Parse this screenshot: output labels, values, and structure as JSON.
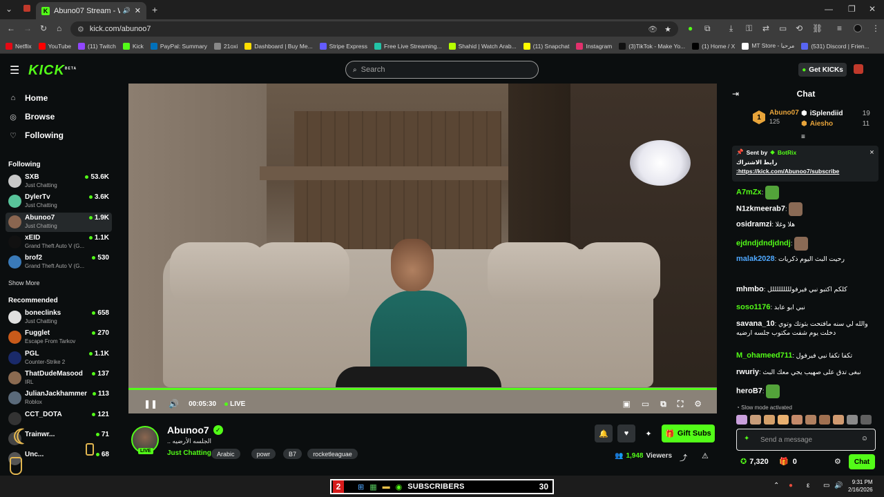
{
  "browser": {
    "tab_title": "Abuno07 Stream - Watch L",
    "url": "kick.com/abunoo7",
    "bookmarks": [
      {
        "label": "Netflix",
        "color": "#e50914"
      },
      {
        "label": "YouTube",
        "color": "#ff0000"
      },
      {
        "label": "(11) Twitch",
        "color": "#9146ff"
      },
      {
        "label": "Kick",
        "color": "#53fc18"
      },
      {
        "label": "PayPal: Summary",
        "color": "#0070ba"
      },
      {
        "label": "21oxi",
        "color": "#888888"
      },
      {
        "label": "Dashboard | Buy Me...",
        "color": "#ffdd00"
      },
      {
        "label": "Stripe Express",
        "color": "#635bff"
      },
      {
        "label": "Free Live Streaming...",
        "color": "#22c3a6"
      },
      {
        "label": "Shahid | Watch Arab...",
        "color": "#b5ff00"
      },
      {
        "label": "(11) Snapchat",
        "color": "#fffc00"
      },
      {
        "label": "Instagram",
        "color": "#e1306c"
      },
      {
        "label": "(3)TikTok - Make Yo...",
        "color": "#111111"
      },
      {
        "label": "(1) Home / X",
        "color": "#000000"
      },
      {
        "label": "MT Store - مرحبا",
        "color": "#ffffff"
      },
      {
        "label": "(531) Discord | Frien...",
        "color": "#5865f2"
      }
    ]
  },
  "header": {
    "logo": "KICK",
    "logo_sup": "BETA",
    "search_placeholder": "Search",
    "get_kicks": "Get KICKs"
  },
  "sidebar": {
    "nav": [
      {
        "label": "Home",
        "icon": "home-icon"
      },
      {
        "label": "Browse",
        "icon": "compass-icon"
      },
      {
        "label": "Following",
        "icon": "heart-icon"
      }
    ],
    "following_title": "Following",
    "following": [
      {
        "name": "SXB",
        "category": "Just Chatting",
        "viewers": "53.6K",
        "color": "#c8c8c8"
      },
      {
        "name": "DylerTv",
        "category": "Just Chatting",
        "viewers": "3.6K",
        "color": "#58c49a"
      },
      {
        "name": "Abunoo7",
        "category": "Just Chatting",
        "viewers": "1.9K",
        "color": "#8a6650"
      },
      {
        "name": "xEID",
        "category": "Grand Theft Auto V (G...",
        "viewers": "1.1K",
        "color": "#111111"
      },
      {
        "name": "brof2",
        "category": "Grand Theft Auto V (G...",
        "viewers": "530",
        "color": "#3a7ab8"
      }
    ],
    "show_more": "Show More",
    "recommended_title": "Recommended",
    "recommended": [
      {
        "name": "boneclinks",
        "category": "Just Chatting",
        "viewers": "658",
        "color": "#e0e0e0"
      },
      {
        "name": "Fugglet",
        "category": "Escape From Tarkov",
        "viewers": "270",
        "color": "#c85a1a"
      },
      {
        "name": "PGL",
        "category": "Counter-Strike 2",
        "viewers": "1.1K",
        "color": "#1a2a6a"
      },
      {
        "name": "ThatDudeMasood",
        "category": "IRL",
        "viewers": "137",
        "color": "#8a6a50"
      },
      {
        "name": "JulianJackhammer",
        "category": "Roblox",
        "viewers": "113",
        "color": "#5a6a7a"
      },
      {
        "name": "CCT_DOTA",
        "category": "",
        "viewers": "121",
        "color": "#333333"
      },
      {
        "name": "Trainwr...",
        "category": "",
        "viewers": "71",
        "color": "#444444"
      },
      {
        "name": "Unc...",
        "category": "",
        "viewers": "68",
        "color": "#555555"
      }
    ]
  },
  "player": {
    "time": "00:05:30",
    "live": "LIVE",
    "progress": 1.0
  },
  "stream": {
    "name": "Abunoo7",
    "title": "الجلسه الأرضيه ..",
    "live_badge": "LIVE",
    "category": "Just Chatting",
    "tags": [
      "Arabic",
      "powr",
      "B7",
      "rocketleaguae"
    ],
    "gift_subs": "Gift Subs",
    "viewers": "1,948",
    "viewers_label": "Viewers"
  },
  "chat": {
    "title": "Chat",
    "leaderboard": [
      {
        "rank": "1",
        "name": "Abuno07",
        "count": "125",
        "color": "#e8a43a"
      },
      {
        "name": "iSplendiid",
        "count": "19",
        "color": "#ffffff"
      },
      {
        "name": "Aiesho",
        "count": "11",
        "color": "#e8a43a"
      }
    ],
    "pinned": {
      "sent_by": "Sent by",
      "sender": "BotRix",
      "line1": "رابط الاشتراك",
      "line2": ":https://kick.com/Abunoo7/subscribe"
    },
    "messages": [
      {
        "user": "A7mZx",
        "text": "",
        "color": "#53fc18"
      },
      {
        "user": "N1zkmeerab7",
        "text": "",
        "color": "#ffffff"
      },
      {
        "user": "osidramzi",
        "text": "هلا وغلا",
        "color": "#ffffff"
      },
      {
        "user": "ejdndjdndjdndj",
        "text": "",
        "color": "#53fc18"
      },
      {
        "user": "malak2028",
        "text": "رحيت البث اليوم ذكريات",
        "color": "#4fa8ff"
      },
      {
        "user": "mhmbo",
        "text": "كلكم اكتبو نبي فيرفولللللللللل",
        "color": "#ffffff"
      },
      {
        "user": "soso1176",
        "text": "نبي ابو عابد",
        "color": "#53fc18"
      },
      {
        "user": "savana_10",
        "text": "والله لي سنه مافتحت بثوتك وتوي دخلت يوم شفت مكتوب جلسه ارضيه",
        "color": "#ffffff"
      },
      {
        "user": "M_ohameed711",
        "text": "تكفا تكفا نبي فيرفول",
        "color": "#53fc18"
      },
      {
        "user": "rwuriy",
        "text": "نبغى تدق على صهيب يجي معك البث",
        "color": "#ffffff"
      },
      {
        "user": "heroB7",
        "text": "",
        "color": "#ffffff"
      }
    ],
    "slow_mode": "Slow mode activated",
    "input_placeholder": "Send a message",
    "points": "7,320",
    "gifts": "0",
    "send": "Chat"
  },
  "taskbar": {
    "left_num": "2",
    "label": "SUBSCRIBERS",
    "right_num": "30",
    "time": "9:31 PM",
    "date": "2/16/2026"
  }
}
